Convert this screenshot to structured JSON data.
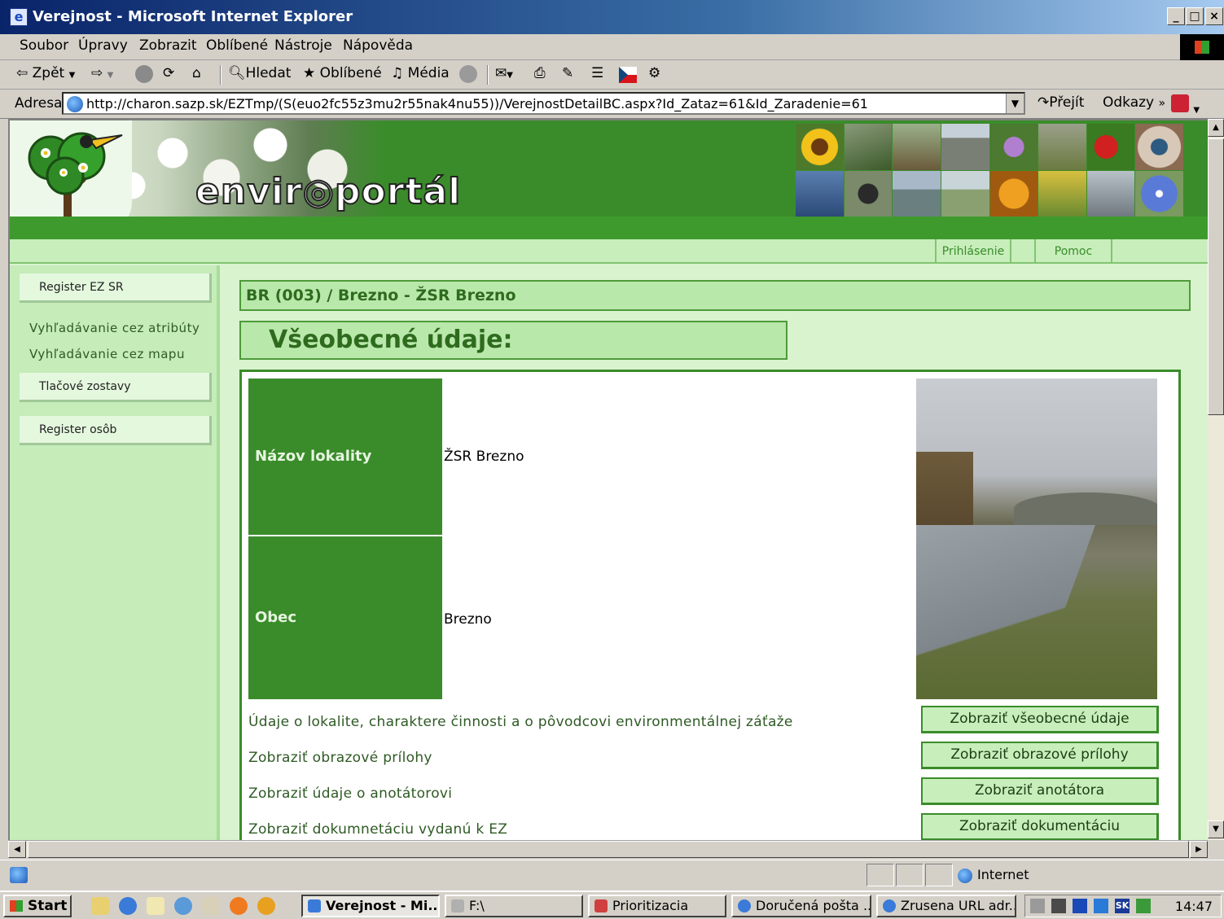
{
  "window": {
    "title": "Verejnost - Microsoft Internet Explorer",
    "controls": [
      "_",
      "□",
      "×"
    ]
  },
  "menu": [
    "Soubor",
    "Úpravy",
    "Zobrazit",
    "Oblíbené",
    "Nástroje",
    "Nápověda"
  ],
  "toolbar": {
    "back": "Zpět",
    "search": "Hledat",
    "favorites": "Oblíbené",
    "media": "Média"
  },
  "address": {
    "label": "Adresa",
    "url": "http://charon.sazp.sk/EZTmp/(S(euo2fc55z3mu2r55nak4nu55))/VerejnostDetailBC.aspx?Id_Zataz=61&Id_Zaradenie=61",
    "go": "Přejít",
    "links": "Odkazy"
  },
  "site": {
    "logo_text": "envir◎portál",
    "top_links": [
      "Prihlásenie",
      "Pomoc"
    ]
  },
  "sidebar": {
    "buttons": [
      "Register EZ SR",
      "Tlačové zostavy",
      "Register osôb"
    ],
    "links": [
      "Vyhľadávanie cez atribúty",
      "Vyhľadávanie cez mapu"
    ]
  },
  "main": {
    "breadcrumb": "BR (003) / Brezno - ŽSR Brezno",
    "section_title": "Všeobecné údaje:",
    "fields": [
      {
        "label": "Názov lokality",
        "value": "ŽSR Brezno"
      },
      {
        "label": "Obec",
        "value": "Brezno"
      }
    ],
    "links": [
      "Údaje o lokalite, charaktere činnosti a o pôvodcovi environmentálnej záťaže",
      "Zobraziť obrazové prílohy",
      "Zobraziť údaje o anotátorovi",
      "Zobraziť dokumnetáciu vydanú k EZ"
    ],
    "buttons": [
      "Zobraziť všeobecné údaje",
      "Zobraziť obrazové prílohy",
      "Zobraziť anotátora",
      "Zobraziť dokumentáciu"
    ]
  },
  "status": {
    "zone": "Internet"
  },
  "taskbar": {
    "start": "Start",
    "tasks": [
      "Verejnost - Mi...",
      "F:\\",
      "Prioritizacia",
      "Doručená pošta ...",
      "Zrusena URL adr..."
    ],
    "lang": "SK",
    "clock": "14:47"
  },
  "colors": {
    "accent_green": "#3a8c2a",
    "page_bg": "#d9f3cf",
    "titlebar": "#0a246a"
  }
}
